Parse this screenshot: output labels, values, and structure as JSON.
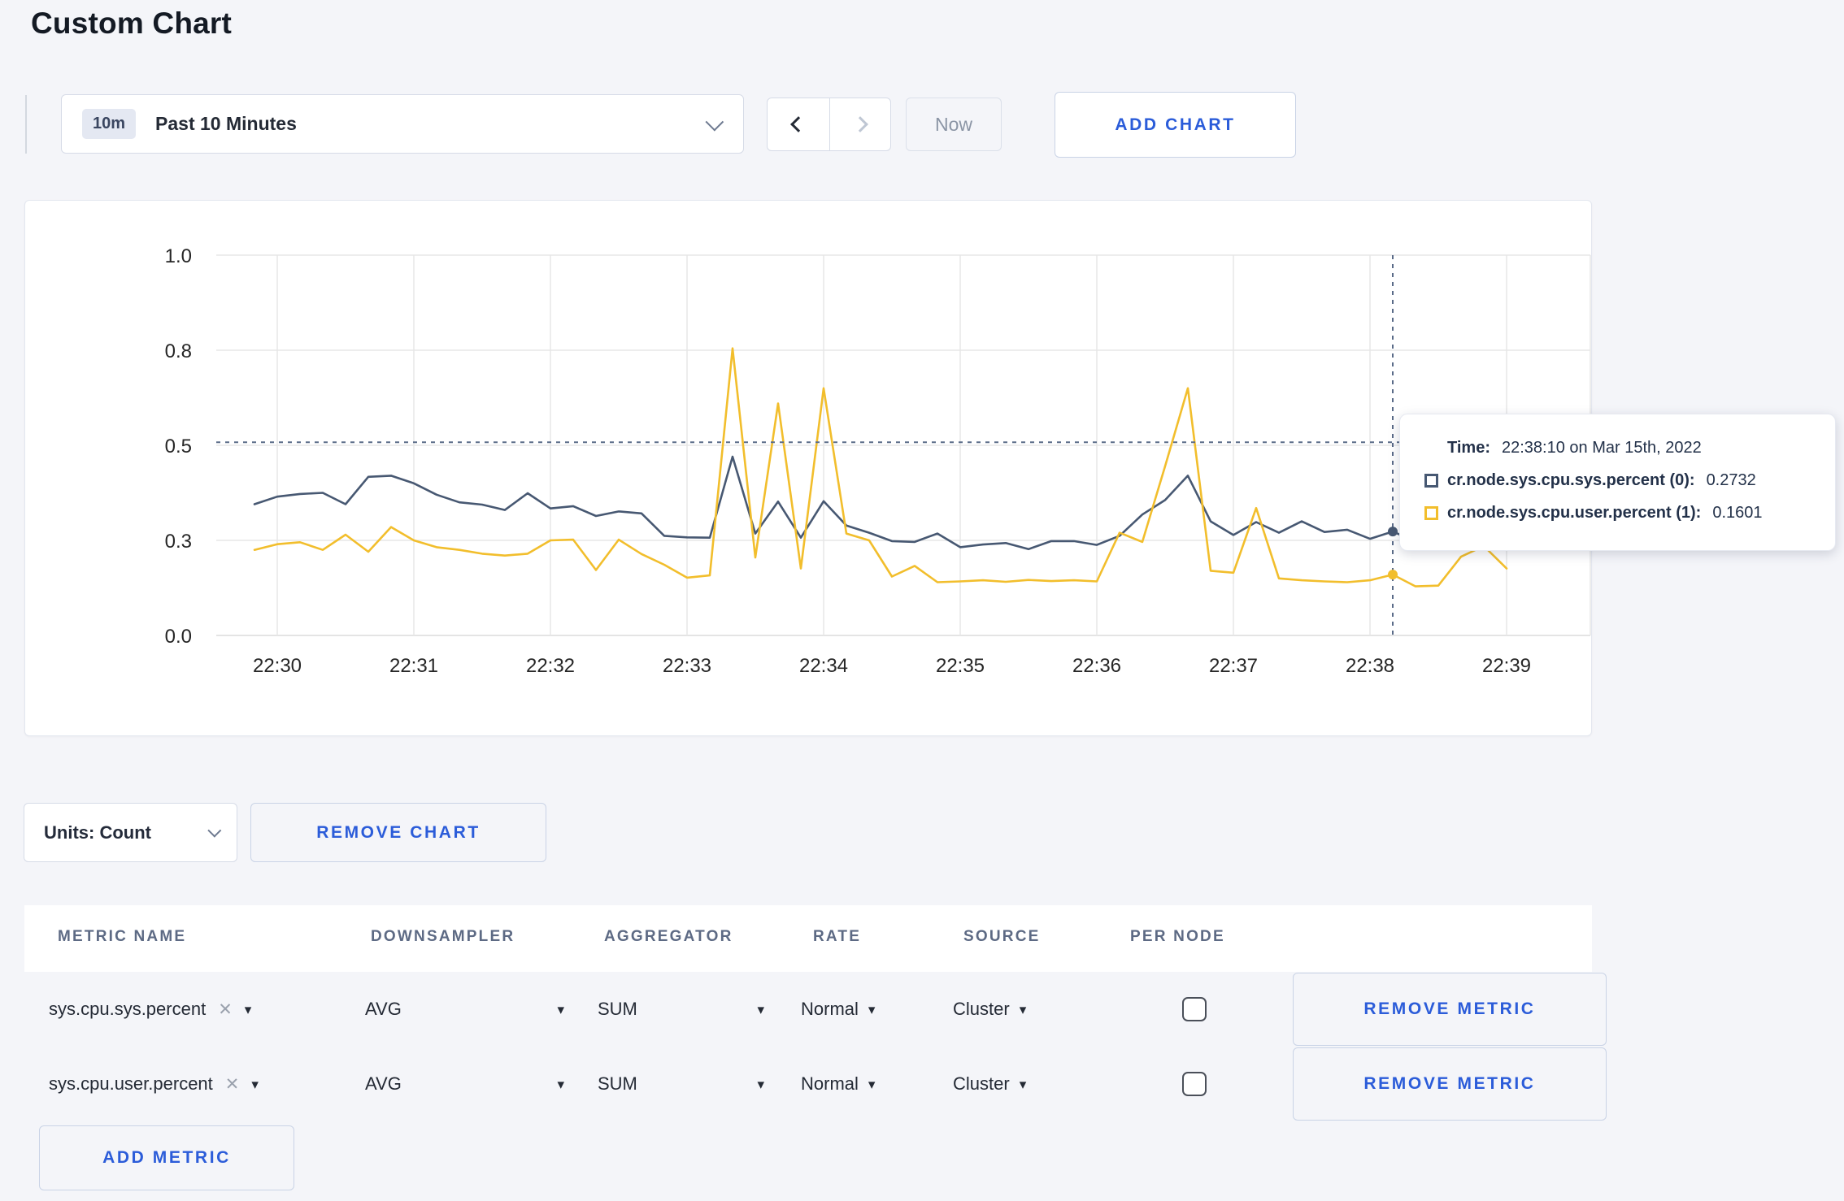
{
  "page": {
    "title": "Custom Chart"
  },
  "toolbar": {
    "range_badge": "10m",
    "range_label": "Past 10 Minutes",
    "now_label": "Now",
    "add_chart_label": "ADD CHART"
  },
  "icons": {
    "caret_down": "▾",
    "close": "✕"
  },
  "chart_data": {
    "type": "line",
    "title": "",
    "xlabel": "",
    "ylabel": "",
    "x_axis": {
      "ticks": [
        {
          "label": "22:30",
          "t": 0
        },
        {
          "label": "22:31",
          "t": 60
        },
        {
          "label": "22:32",
          "t": 120
        },
        {
          "label": "22:33",
          "t": 180
        },
        {
          "label": "22:34",
          "t": 240
        },
        {
          "label": "22:35",
          "t": 300
        },
        {
          "label": "22:36",
          "t": 360
        },
        {
          "label": "22:37",
          "t": 420
        },
        {
          "label": "22:38",
          "t": 480
        },
        {
          "label": "22:39",
          "t": 540
        }
      ]
    },
    "y_axis": {
      "domain": [
        0,
        1
      ],
      "ticks": [
        {
          "label": "0.0",
          "v": 0
        },
        {
          "label": "0.3",
          "v": 0.25
        },
        {
          "label": "0.5",
          "v": 0.5
        },
        {
          "label": "0.8",
          "v": 0.75
        },
        {
          "label": "1.0",
          "v": 1.0
        }
      ]
    },
    "grid": true,
    "legend_position": "tooltip",
    "series": [
      {
        "name": "cr.node.sys.cpu.sys.percent",
        "color": "#475872",
        "points": [
          [
            -10,
            0.345
          ],
          [
            0,
            0.365
          ],
          [
            10,
            0.372
          ],
          [
            20,
            0.375
          ],
          [
            30,
            0.345
          ],
          [
            40,
            0.417
          ],
          [
            50,
            0.42
          ],
          [
            60,
            0.4
          ],
          [
            70,
            0.37
          ],
          [
            80,
            0.35
          ],
          [
            90,
            0.344
          ],
          [
            100,
            0.33
          ],
          [
            110,
            0.374
          ],
          [
            120,
            0.334
          ],
          [
            130,
            0.34
          ],
          [
            140,
            0.314
          ],
          [
            150,
            0.326
          ],
          [
            160,
            0.321
          ],
          [
            170,
            0.262
          ],
          [
            180,
            0.258
          ],
          [
            190,
            0.257
          ],
          [
            200,
            0.47
          ],
          [
            210,
            0.268
          ],
          [
            220,
            0.352
          ],
          [
            230,
            0.257
          ],
          [
            240,
            0.353
          ],
          [
            250,
            0.289
          ],
          [
            260,
            0.27
          ],
          [
            270,
            0.248
          ],
          [
            280,
            0.246
          ],
          [
            290,
            0.268
          ],
          [
            300,
            0.232
          ],
          [
            310,
            0.239
          ],
          [
            320,
            0.243
          ],
          [
            330,
            0.227
          ],
          [
            340,
            0.248
          ],
          [
            350,
            0.248
          ],
          [
            360,
            0.238
          ],
          [
            370,
            0.262
          ],
          [
            380,
            0.318
          ],
          [
            390,
            0.356
          ],
          [
            400,
            0.42
          ],
          [
            410,
            0.3
          ],
          [
            420,
            0.264
          ],
          [
            430,
            0.298
          ],
          [
            440,
            0.27
          ],
          [
            450,
            0.3
          ],
          [
            460,
            0.272
          ],
          [
            470,
            0.278
          ],
          [
            480,
            0.254
          ],
          [
            490,
            0.2732
          ],
          [
            500,
            0.247
          ]
        ]
      },
      {
        "name": "cr.node.sys.cpu.user.percent",
        "color": "#F2BE2C",
        "points": [
          [
            -10,
            0.225
          ],
          [
            0,
            0.24
          ],
          [
            10,
            0.245
          ],
          [
            20,
            0.225
          ],
          [
            30,
            0.265
          ],
          [
            40,
            0.22
          ],
          [
            50,
            0.285
          ],
          [
            60,
            0.25
          ],
          [
            70,
            0.232
          ],
          [
            80,
            0.225
          ],
          [
            90,
            0.215
          ],
          [
            100,
            0.21
          ],
          [
            110,
            0.215
          ],
          [
            120,
            0.25
          ],
          [
            130,
            0.252
          ],
          [
            140,
            0.172
          ],
          [
            150,
            0.252
          ],
          [
            160,
            0.214
          ],
          [
            170,
            0.186
          ],
          [
            180,
            0.152
          ],
          [
            190,
            0.158
          ],
          [
            200,
            0.755
          ],
          [
            210,
            0.205
          ],
          [
            220,
            0.61
          ],
          [
            230,
            0.176
          ],
          [
            240,
            0.65
          ],
          [
            250,
            0.268
          ],
          [
            260,
            0.25
          ],
          [
            270,
            0.155
          ],
          [
            280,
            0.183
          ],
          [
            290,
            0.14
          ],
          [
            300,
            0.142
          ],
          [
            310,
            0.145
          ],
          [
            320,
            0.141
          ],
          [
            330,
            0.146
          ],
          [
            340,
            0.143
          ],
          [
            350,
            0.145
          ],
          [
            360,
            0.142
          ],
          [
            370,
            0.27
          ],
          [
            380,
            0.246
          ],
          [
            390,
            0.445
          ],
          [
            400,
            0.65
          ],
          [
            410,
            0.17
          ],
          [
            420,
            0.165
          ],
          [
            430,
            0.335
          ],
          [
            440,
            0.15
          ],
          [
            450,
            0.145
          ],
          [
            460,
            0.142
          ],
          [
            470,
            0.14
          ],
          [
            480,
            0.145
          ],
          [
            490,
            0.1601
          ],
          [
            500,
            0.129
          ],
          [
            510,
            0.131
          ],
          [
            520,
            0.207
          ],
          [
            530,
            0.235
          ],
          [
            540,
            0.176
          ]
        ]
      }
    ],
    "crosshair": {
      "t": 490,
      "hover_value": 0.508,
      "markers": [
        {
          "series": 0,
          "v": 0.2732
        },
        {
          "series": 1,
          "v": 0.1601
        }
      ]
    }
  },
  "tooltip": {
    "time_label": "Time:",
    "time_value": "22:38:10 on Mar 15th, 2022",
    "rows": [
      {
        "label": "cr.node.sys.cpu.sys.percent (0):",
        "value": "0.2732",
        "color": "#475872"
      },
      {
        "label": "cr.node.sys.cpu.user.percent (1):",
        "value": "0.1601",
        "color": "#F2BE2C"
      }
    ]
  },
  "units_bar": {
    "units_label": "Units: Count",
    "remove_chart_label": "REMOVE CHART"
  },
  "metrics_table": {
    "headers": [
      "METRIC NAME",
      "DOWNSAMPLER",
      "AGGREGATOR",
      "RATE",
      "SOURCE",
      "PER NODE"
    ],
    "rows": [
      {
        "name": "sys.cpu.sys.percent",
        "downsampler": "AVG",
        "aggregator": "SUM",
        "rate": "Normal",
        "source": "Cluster",
        "per_node_checked": false,
        "remove_label": "REMOVE METRIC"
      },
      {
        "name": "sys.cpu.user.percent",
        "downsampler": "AVG",
        "aggregator": "SUM",
        "rate": "Normal",
        "source": "Cluster",
        "per_node_checked": false,
        "remove_label": "REMOVE METRIC"
      }
    ],
    "add_metric_label": "ADD METRIC"
  },
  "colors": {
    "accent_blue": "#2b5cd9",
    "series_sys": "#475872",
    "series_user": "#F2BE2C",
    "crosshair": "#5a6b88",
    "grid": "#e7e7e7",
    "axis_line": "#dcdcdc",
    "page_bg": "#f4f5f9"
  }
}
